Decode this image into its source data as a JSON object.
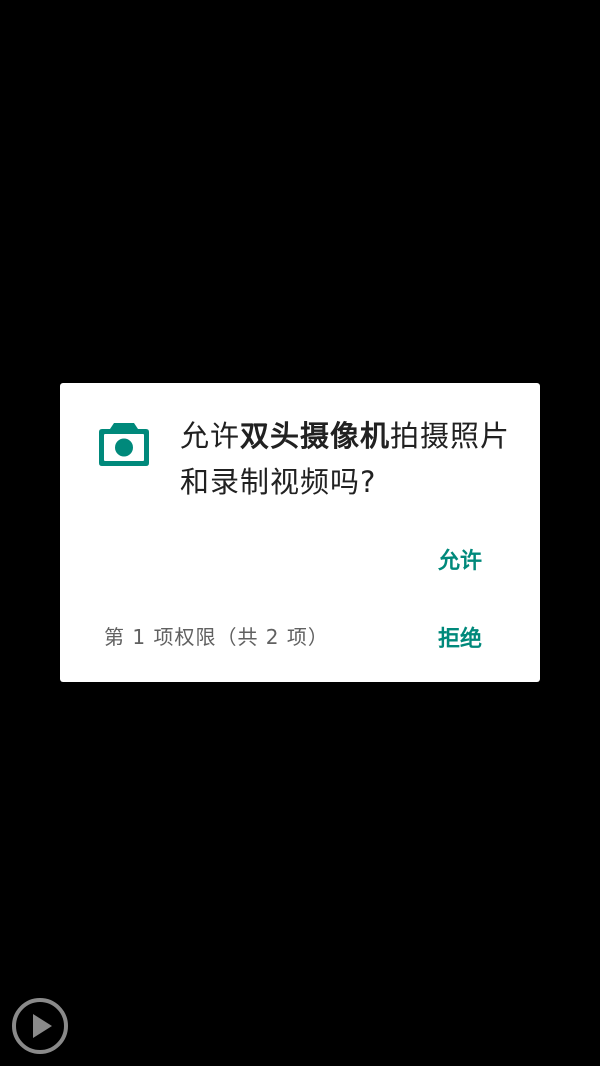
{
  "dialog": {
    "icon": "camera-icon",
    "message_prefix": "允许",
    "app_name": "双头摄像机",
    "message_suffix": "拍摄照片和录制视频吗?",
    "allow_label": "允许",
    "deny_label": "拒绝",
    "counter_text": "第 1 项权限（共 2 项）"
  },
  "overlay": {
    "play_icon": "play-circle-icon"
  },
  "colors": {
    "background": "#000000",
    "dialog_bg": "#ffffff",
    "accent": "#00897b",
    "text_primary": "#212121",
    "text_secondary": "#616161"
  }
}
